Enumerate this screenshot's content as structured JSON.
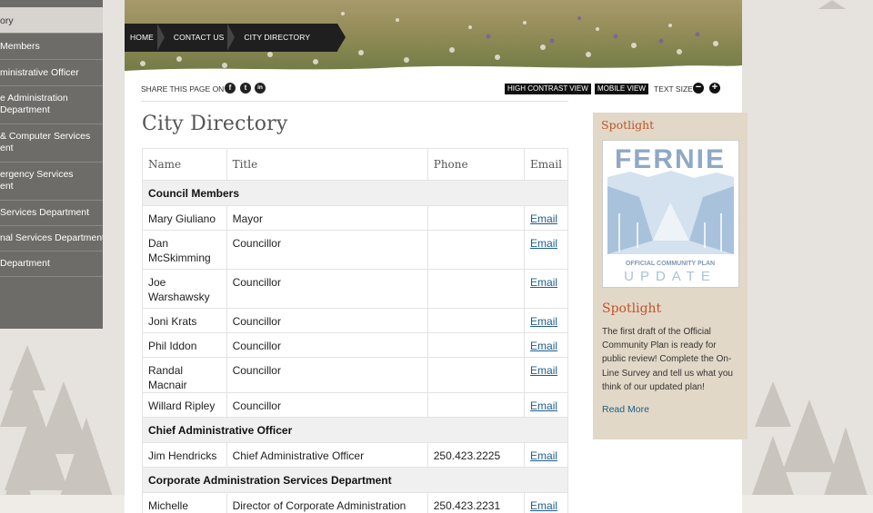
{
  "sidebar": {
    "items": [
      {
        "label1": "ory",
        "label2": ""
      },
      {
        "label1": "Members",
        "label2": ""
      },
      {
        "label1": "ministrative Officer",
        "label2": ""
      },
      {
        "label1": "e Administration",
        "label2": " Department"
      },
      {
        "label1": " & Computer Services",
        "label2": "ent"
      },
      {
        "label1": "ergency Services",
        "label2": "ent"
      },
      {
        "label1": "Services Department",
        "label2": ""
      },
      {
        "label1": "nal Services Department",
        "label2": ""
      },
      {
        "label1": " Department",
        "label2": ""
      }
    ]
  },
  "breadcrumb": {
    "home": "HOME",
    "contact": "CONTACT US",
    "current": "CITY DIRECTORY"
  },
  "toolbar": {
    "share_label": "SHARE THIS PAGE ON",
    "high_contrast": "HIGH CONTRAST VIEW",
    "mobile": "MOBILE VIEW",
    "text_size": "TEXT SIZE",
    "facebook": "f",
    "twitter": "t",
    "linkedin": "in",
    "minus": "−",
    "plus": "+"
  },
  "page": {
    "title": "City Directory"
  },
  "table": {
    "headers": {
      "name": "Name",
      "title": "Title",
      "phone": "Phone",
      "email": "Email"
    },
    "groups": [
      {
        "name": "Council Members"
      },
      {
        "name": "Chief Administrative Officer"
      },
      {
        "name": "Corporate Administration Services Department"
      }
    ],
    "rows": [
      {
        "name": "Mary Giuliano",
        "title": "Mayor",
        "phone": "",
        "email": "Email"
      },
      {
        "name": "Dan McSkimming",
        "title": "Councillor",
        "phone": "",
        "email": "Email"
      },
      {
        "name": "Joe Warshawsky",
        "title": "Councillor",
        "phone": "",
        "email": "Email"
      },
      {
        "name": "Joni Krats",
        "title": "Councillor",
        "phone": "",
        "email": "Email"
      },
      {
        "name": "Phil Iddon",
        "title": "Councillor",
        "phone": "",
        "email": "Email"
      },
      {
        "name": "Randal Macnair",
        "title": "Councillor",
        "phone": "",
        "email": "Email"
      },
      {
        "name": "Willard Ripley",
        "title": "Councillor",
        "phone": "",
        "email": "Email"
      },
      {
        "name": "Jim Hendricks",
        "title": "Chief Administrative Officer",
        "phone": "250.423.2225",
        "email": "Email"
      },
      {
        "name": "Michelle Martineau",
        "title": "Director of Corporate Administration Services",
        "phone": "250.423.2231",
        "email": "Email"
      }
    ]
  },
  "spotlight": {
    "heading": "Spotlight",
    "image": {
      "brand": "FERNIE",
      "sub": "OFFICIAL COMMUNITY PLAN",
      "update": "UPDATE"
    },
    "heading2": "Spotlight",
    "body": "The first draft of the Official Community Plan is ready for public review! Complete the On-Line Survey and tell us what you think of our updated plan!",
    "link": "Read More"
  },
  "colors": {
    "accent": "#c0542a",
    "link": "#1f5d8c",
    "sidebar": "#6e6c69"
  }
}
